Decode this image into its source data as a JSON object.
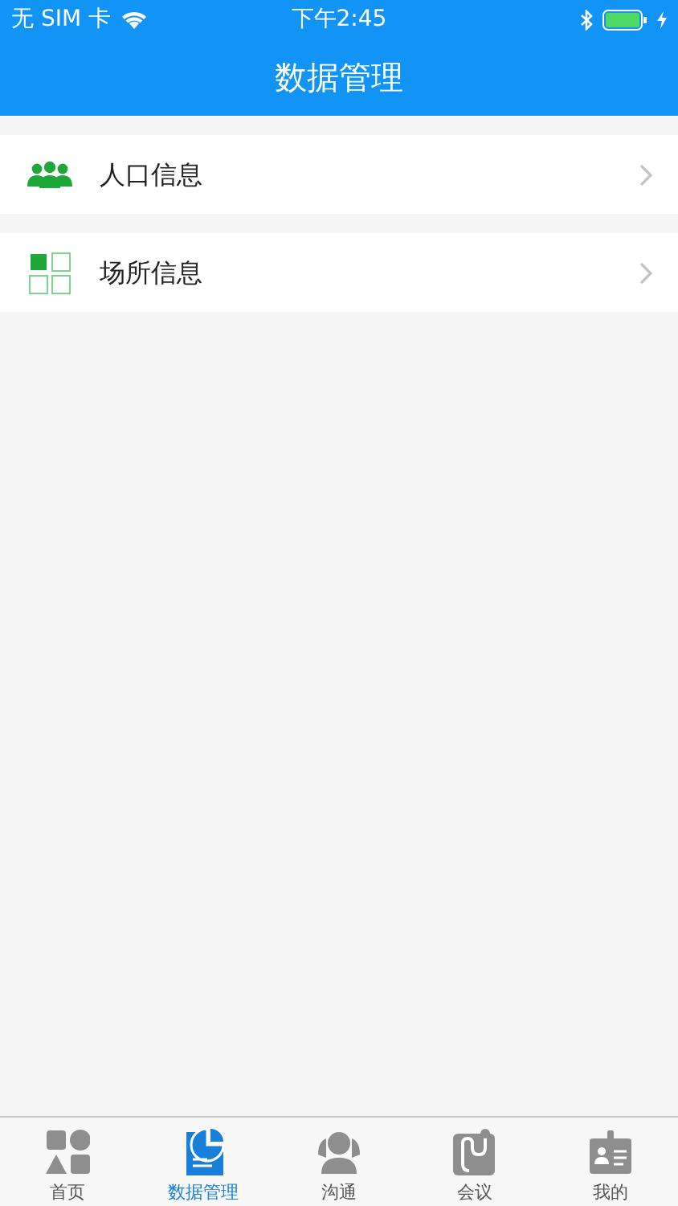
{
  "status_bar": {
    "carrier": "无 SIM 卡",
    "time": "下午2:45"
  },
  "nav_bar": {
    "title": "数据管理"
  },
  "menu_items": [
    {
      "kind": "people",
      "label": "人口信息"
    },
    {
      "kind": "places",
      "label": "场所信息"
    }
  ],
  "tab_bar": [
    {
      "kind": "home",
      "label": "首页",
      "selected": false
    },
    {
      "kind": "data",
      "label": "数据管理",
      "selected": true
    },
    {
      "kind": "chat",
      "label": "沟通",
      "selected": false
    },
    {
      "kind": "meeting",
      "label": "会议",
      "selected": false
    },
    {
      "kind": "profile",
      "label": "我的",
      "selected": false
    }
  ]
}
